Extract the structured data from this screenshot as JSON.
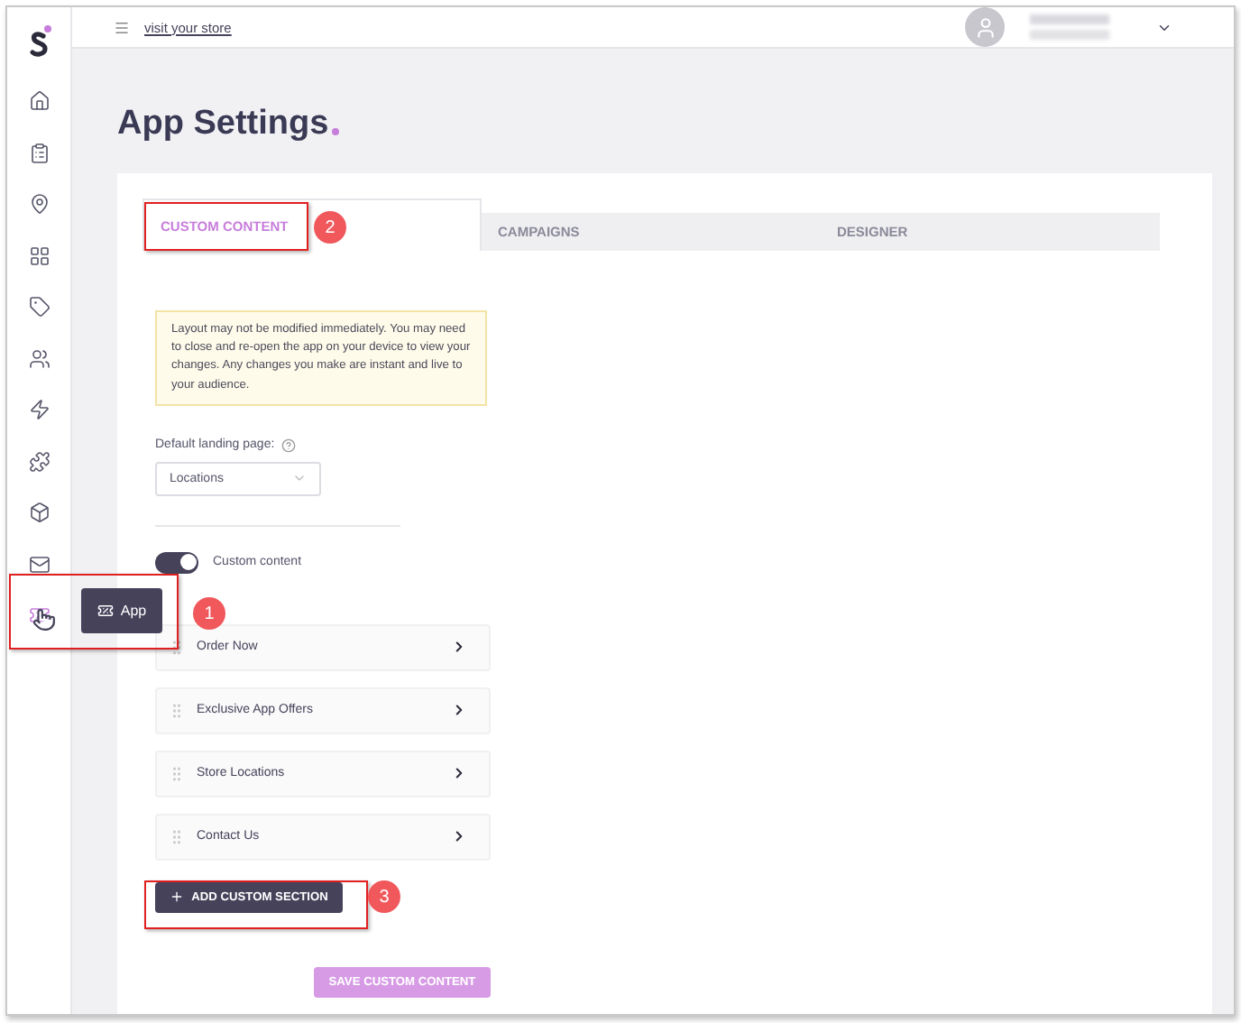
{
  "sidebar": {
    "items": [
      {
        "selected": false
      },
      {
        "selected": false
      },
      {
        "selected": false
      },
      {
        "selected": false
      },
      {
        "selected": false
      },
      {
        "selected": false
      },
      {
        "selected": false
      },
      {
        "selected": false
      },
      {
        "selected": false
      },
      {
        "selected": false
      },
      {
        "selected": true
      }
    ],
    "tooltip": "App"
  },
  "topbar": {
    "link": "visit your store"
  },
  "title": "App Settings",
  "tabs": [
    {
      "label": "CUSTOM CONTENT",
      "selected": true
    },
    {
      "label": "CAMPAIGNS",
      "selected": false
    },
    {
      "label": "DESIGNER",
      "selected": false
    }
  ],
  "notice": "Layout may not be modified immediately. You may need to close and re-open the app on your device to view your changes. Any changes you make are instant and live to your audience.",
  "landing": {
    "label": "Default landing page:",
    "value": "Locations"
  },
  "custom_toggle": {
    "label": "Custom content",
    "on": true
  },
  "sections": [
    {
      "label": "Order Now"
    },
    {
      "label": "Exclusive App Offers"
    },
    {
      "label": "Store Locations"
    },
    {
      "label": "Contact Us"
    }
  ],
  "add_button": "ADD CUSTOM SECTION",
  "save_button": "SAVE CUSTOM CONTENT",
  "annotations": [
    {
      "label": "1"
    },
    {
      "label": "2"
    },
    {
      "label": "3"
    }
  ]
}
